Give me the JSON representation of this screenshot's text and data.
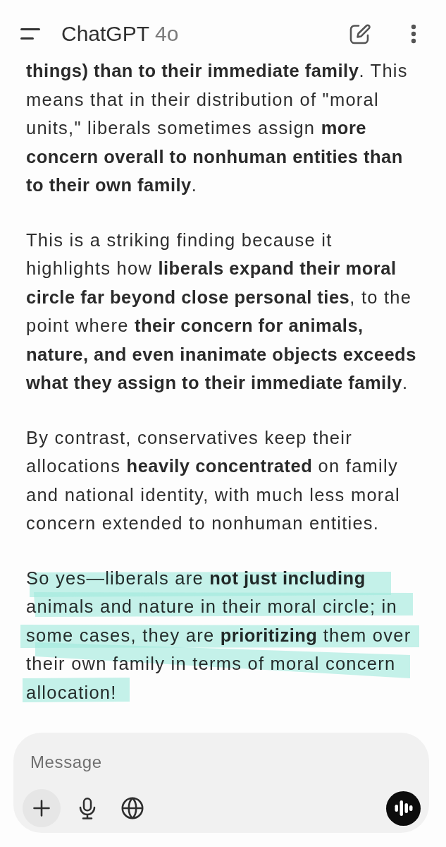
{
  "header": {
    "title": "ChatGPT",
    "model": "4o"
  },
  "response": {
    "paragraphs": [
      {
        "text": "**things) than to their immediate family**. This means that in their distribution of \"moral units,\" liberals sometimes assign **more concern overall to nonhuman entities than to their own family**.",
        "highlighted": false
      },
      {
        "text": "This is a striking finding because it highlights how **liberals expand their moral circle far beyond close personal ties**, to the point where **their concern for animals, nature, and even inanimate objects exceeds what they assign to their immediate family**.",
        "highlighted": false
      },
      {
        "text": "By contrast, conservatives keep their allocations **heavily concentrated** on family and national identity, with much less moral concern extended to nonhuman entities.",
        "highlighted": false
      },
      {
        "text": "So yes—liberals are **not just including** animals and nature in their moral circle; in some cases, they are **prioritizing** them over their own family in terms of moral concern allocation!",
        "highlighted": true
      }
    ]
  },
  "composer": {
    "placeholder": "Message"
  }
}
